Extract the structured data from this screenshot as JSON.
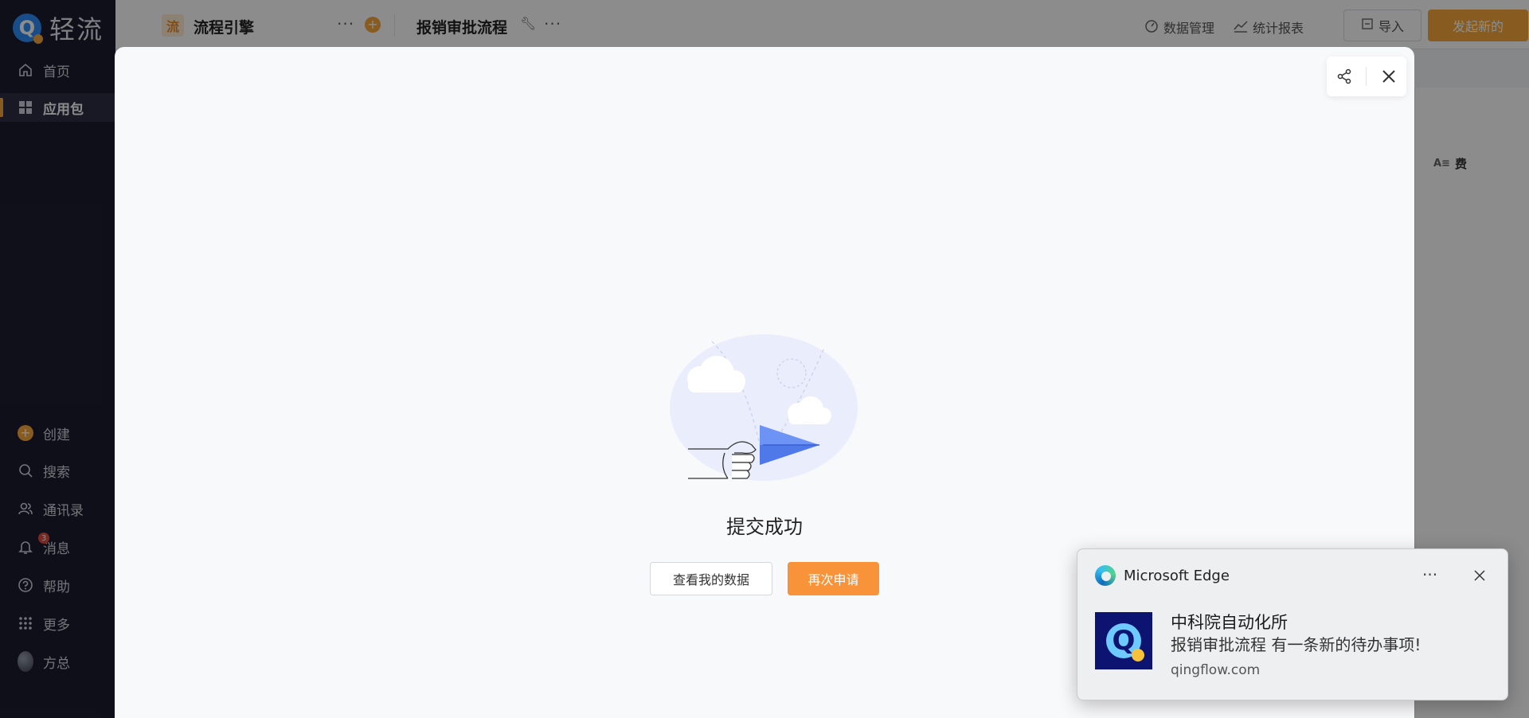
{
  "sidebar": {
    "logo_text": "轻流",
    "items": [
      {
        "label": "首页"
      },
      {
        "label": "应用包"
      },
      {
        "label": "创建"
      },
      {
        "label": "搜索"
      },
      {
        "label": "通讯录"
      },
      {
        "label": "消息",
        "badge": "3"
      },
      {
        "label": "帮助"
      },
      {
        "label": "更多"
      },
      {
        "label": "方总"
      }
    ]
  },
  "topbar": {
    "app_tag": "流",
    "app_name": "流程引擎",
    "flow_title": "报销审批流程",
    "data_manage": "数据管理",
    "stats_report": "统计报表",
    "import_label": "导入",
    "start_label": "发起新的"
  },
  "background": {
    "column_label": "费"
  },
  "modal": {
    "success_title": "提交成功",
    "view_data_label": "查看我的数据",
    "apply_again_label": "再次申请"
  },
  "toast": {
    "app_name": "Microsoft Edge",
    "more_label": "···",
    "title": "中科院自动化所",
    "body": "报销审批流程 有一条新的待办事项!",
    "domain": "qingflow.com"
  },
  "colors": {
    "accent": "#f7a83b",
    "sidebar_bg": "#1b1d2e"
  }
}
